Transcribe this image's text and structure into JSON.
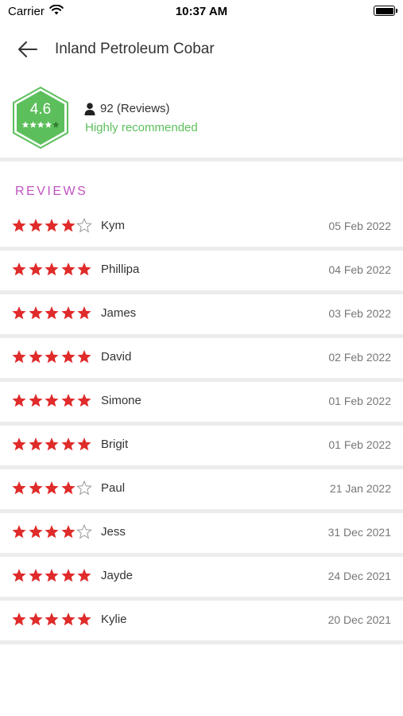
{
  "status_bar": {
    "carrier": "Carrier",
    "time": "10:37 AM"
  },
  "header": {
    "title": "Inland Petroleum Cobar"
  },
  "summary": {
    "score": "4.6",
    "badge_stars": 4,
    "review_count": "92 (Reviews)",
    "recommendation": "Highly recommended"
  },
  "section_title": "REVIEWS",
  "colors": {
    "star": "#e02b2b",
    "badge": "#5cbf5c",
    "accent": "#c054c0",
    "divider": "#ececec"
  },
  "reviews": [
    {
      "name": "Kym",
      "date": "05 Feb 2022",
      "rating": 4
    },
    {
      "name": "Phillipa",
      "date": "04 Feb 2022",
      "rating": 5
    },
    {
      "name": "James",
      "date": "03 Feb 2022",
      "rating": 5
    },
    {
      "name": "David",
      "date": "02 Feb 2022",
      "rating": 5
    },
    {
      "name": "Simone",
      "date": "01 Feb 2022",
      "rating": 5
    },
    {
      "name": "Brigit",
      "date": "01 Feb 2022",
      "rating": 5
    },
    {
      "name": "Paul",
      "date": "21 Jan 2022",
      "rating": 4
    },
    {
      "name": "Jess",
      "date": "31 Dec 2021",
      "rating": 4
    },
    {
      "name": "Jayde",
      "date": "24 Dec 2021",
      "rating": 5
    },
    {
      "name": "Kylie",
      "date": "20 Dec 2021",
      "rating": 5
    }
  ]
}
